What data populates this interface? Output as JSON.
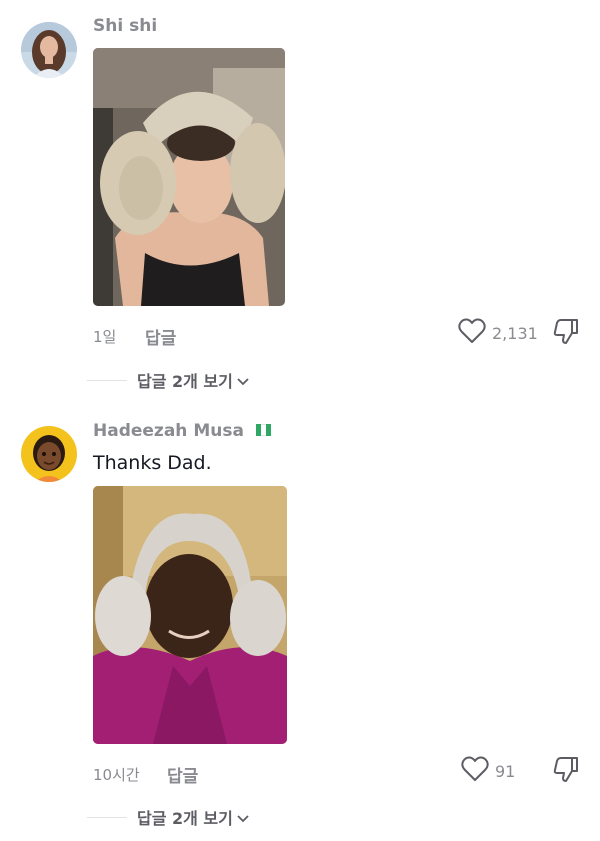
{
  "comments": [
    {
      "username": "Shi shi",
      "text": "",
      "time": "1일",
      "reply_label": "답글",
      "like_count": "2,131",
      "view_replies_label": "답글 2개 보기"
    },
    {
      "username": "Hadeezah Musa",
      "flag_colors": [
        "#2fa765",
        "#ffffff",
        "#2fa765"
      ],
      "text": "Thanks Dad.",
      "time": "10시간",
      "reply_label": "답글",
      "like_count": "91",
      "view_replies_label": "답글 2개 보기"
    }
  ],
  "icons": {
    "like": "heart-outline-icon",
    "dislike": "thumbs-down-outline-icon",
    "expand": "chevron-down-icon"
  },
  "colors": {
    "secondary_text": "#8a8b91",
    "primary_text": "#161823"
  }
}
